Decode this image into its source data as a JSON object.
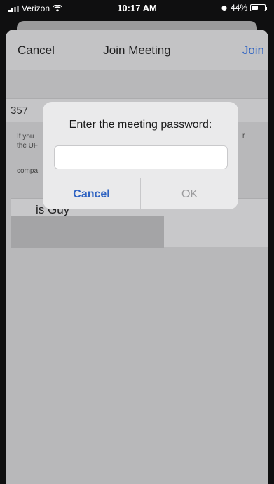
{
  "status": {
    "carrier": "Verizon",
    "time": "10:17 AM",
    "battery": "44%",
    "battery_level": 0.44
  },
  "nav": {
    "cancel_label": "Cancel",
    "title": "Join Meeting",
    "join_label": "Join"
  },
  "form": {
    "meeting_id_partial": "357",
    "hint_line1": "If you",
    "hint_line2": "the UF",
    "hint_trailing": "r",
    "hint_company": "compa",
    "name_partial": "is Guy"
  },
  "dialog": {
    "title": "Enter the meeting password:",
    "password_value": "",
    "cancel_label": "Cancel",
    "ok_label": "OK"
  }
}
